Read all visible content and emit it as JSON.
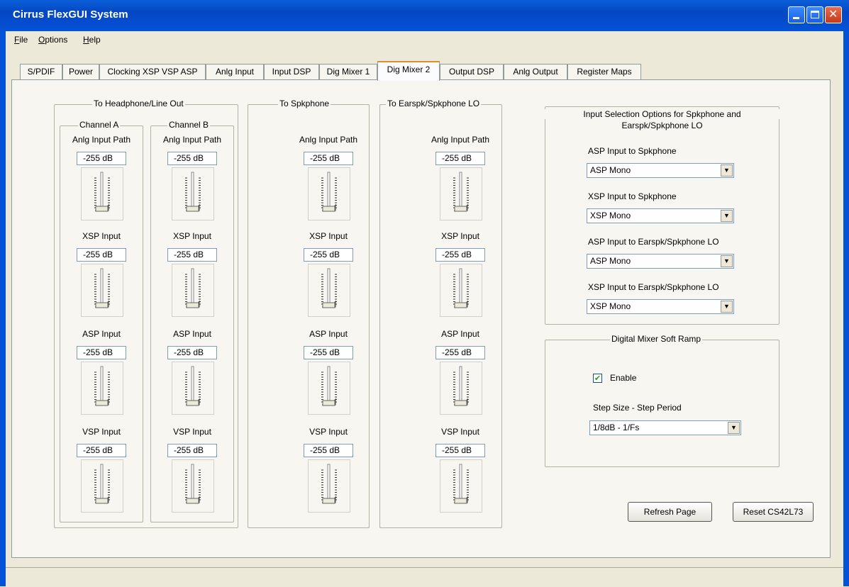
{
  "window": {
    "title": "Cirrus FlexGUI System"
  },
  "menu": {
    "file": {
      "mnemonic": "F",
      "rest": "ile"
    },
    "options": {
      "mnemonic": "O",
      "rest": "ptions"
    },
    "help": {
      "mnemonic": "H",
      "rest": "elp"
    }
  },
  "tabs": [
    "S/PDIF",
    "Power",
    "Clocking XSP VSP ASP",
    "Anlg Input",
    "Input DSP",
    "Dig Mixer 1",
    "Dig Mixer 2",
    "Output DSP",
    "Anlg Output",
    "Register Maps"
  ],
  "active_tab": "Dig Mixer 2",
  "groups": {
    "headphone": "To Headphone/Line Out",
    "channel_a": "Channel A",
    "channel_b": "Channel B",
    "spkphone": "To Spkphone",
    "earspk": "To Earspk/Spkphone LO"
  },
  "inputs": [
    "Anlg Input Path",
    "XSP Input",
    "ASP Input",
    "VSP Input"
  ],
  "default_db": "-255 dB",
  "columns": [
    {
      "id": "channel-a",
      "values": [
        "-255 dB",
        "-255 dB",
        "-255 dB",
        "-255 dB"
      ]
    },
    {
      "id": "channel-b",
      "values": [
        "-255 dB",
        "-255 dB",
        "-255 dB",
        "-255 dB"
      ]
    },
    {
      "id": "spkphone",
      "values": [
        "-255 dB",
        "-255 dB",
        "-255 dB",
        "-255 dB"
      ]
    },
    {
      "id": "earspk",
      "values": [
        "-255 dB",
        "-255 dB",
        "-255 dB",
        "-255 dB"
      ]
    }
  ],
  "input_selection": {
    "title_line1": "Input Selection Options for Spkphone and",
    "title_line2": "Earspk/Spkphone LO",
    "fields": [
      {
        "label": "ASP Input to Spkphone",
        "value": "ASP Mono"
      },
      {
        "label": "XSP Input to Spkphone",
        "value": "XSP Mono"
      },
      {
        "label": "ASP Input to Earspk/Spkphone LO",
        "value": "ASP Mono"
      },
      {
        "label": "XSP Input to Earspk/Spkphone LO",
        "value": "XSP Mono"
      }
    ]
  },
  "soft_ramp": {
    "title": "Digital Mixer Soft Ramp",
    "enable_label": "Enable",
    "enable_checked": true,
    "step_label": "Step Size - Step Period",
    "step_value": "1/8dB - 1/Fs"
  },
  "buttons": {
    "refresh": "Refresh Page",
    "reset": "Reset CS42L73"
  }
}
